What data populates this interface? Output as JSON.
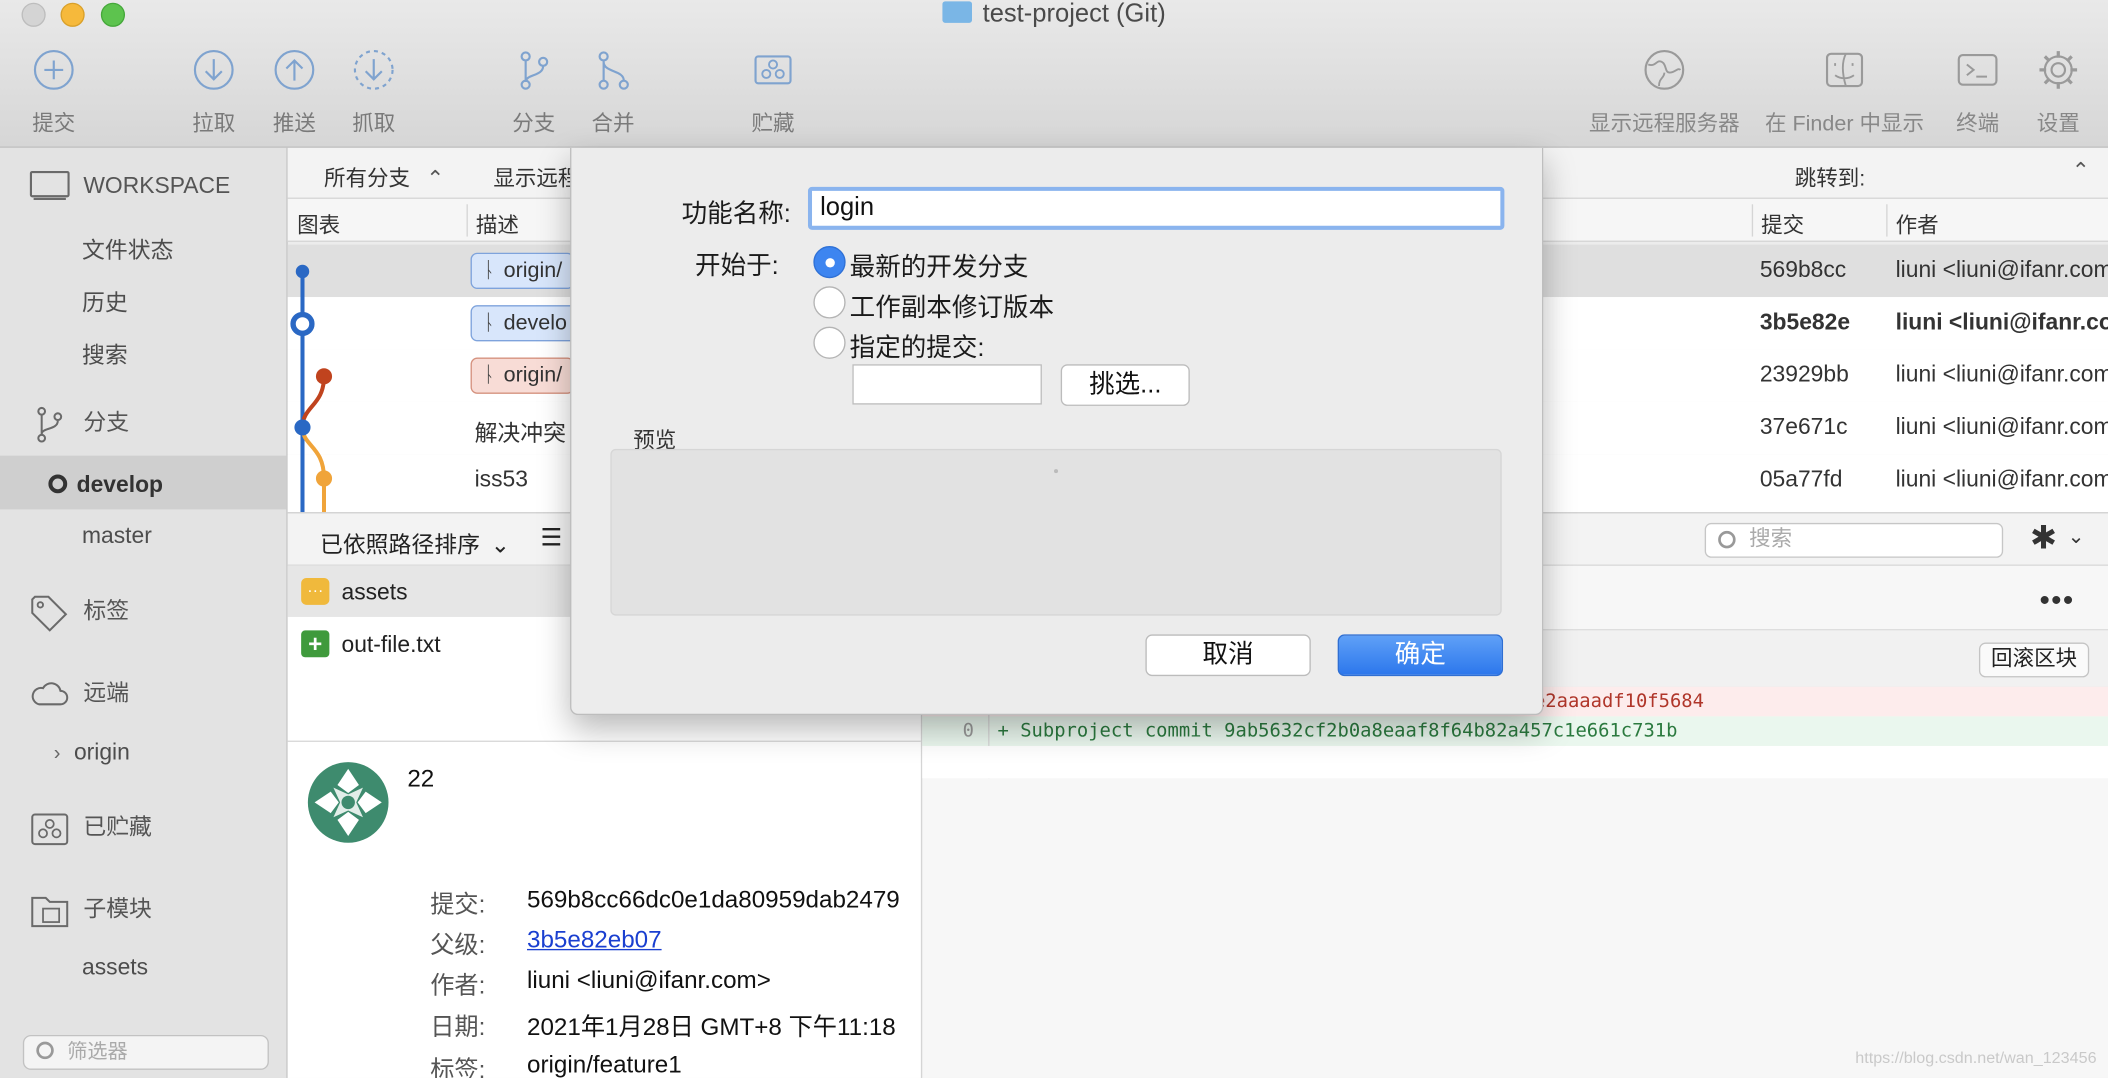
{
  "window": {
    "title": "test-project (Git)"
  },
  "toolbar": {
    "commit": "提交",
    "pull": "拉取",
    "push": "推送",
    "fetch": "抓取",
    "branch": "分支",
    "merge": "合并",
    "stash": "贮藏",
    "show_remote": "显示远程服务器",
    "show_in_finder": "在 Finder 中显示",
    "terminal": "终端",
    "settings": "设置"
  },
  "sidebar": {
    "workspace": "WORKSPACE",
    "file_status": "文件状态",
    "history": "历史",
    "search": "搜索",
    "branches": "分支",
    "develop": "develop",
    "master": "master",
    "tags": "标签",
    "remotes": "远端",
    "origin": "origin",
    "stashes": "已贮藏",
    "submodules": "子模块",
    "assets": "assets",
    "filter_placeholder": "筛选器"
  },
  "branchbar": {
    "all_branches": "所有分支",
    "show_remote": "显示远程",
    "jump_to": "跳转到:"
  },
  "columns": {
    "graph": "图表",
    "description": "描述",
    "commit": "提交",
    "author": "作者"
  },
  "commits": [
    {
      "desc": "origin/",
      "hash": "569b8cc",
      "author": "liuni <liuni@ifanr.com>"
    },
    {
      "desc": "develo",
      "hash": "3b5e82e",
      "author": "liuni <liuni@ifanr.com>"
    },
    {
      "desc": "origin/",
      "hash": "23929bb",
      "author": "liuni <liuni@ifanr.com>"
    },
    {
      "desc": "解决冲突",
      "hash": "37e671c",
      "author": "liuni <liuni@ifanr.com>"
    },
    {
      "desc": "iss53",
      "hash": "05a77fd",
      "author": "liuni <liuni@ifanr.com>"
    }
  ],
  "files": {
    "sort_label": "已依照路径排序",
    "search_placeholder": "搜索",
    "items": [
      "assets",
      "out-file.txt"
    ]
  },
  "details": {
    "message": "22",
    "commit_label": "提交:",
    "commit_value": "569b8cc66dc0e1da80959dab2479",
    "parent_label": "父级:",
    "parent_value": "3b5e82eb07",
    "author_label": "作者:",
    "author_value": "liuni <liuni@ifanr.com>",
    "date_label": "日期:",
    "date_value": "2021年1月28日 GMT+8 下午11:18",
    "tags_label": "标签:",
    "tags_value": "origin/feature1"
  },
  "diff": {
    "revert_hunk": "回滚区块",
    "removed_line": "e2aaaadf10f5684",
    "added_lineno": "0",
    "added_line": "+ Subproject commit 9ab5632cf2b0a8eaaf8f64b82a457c1e661c731b"
  },
  "dialog": {
    "name_label": "功能名称:",
    "name_value": "login",
    "start_label": "开始于:",
    "opt_latest": "最新的开发分支",
    "opt_working": "工作副本修订版本",
    "opt_commit": "指定的提交:",
    "pick_button": "挑选...",
    "preview_label": "预览",
    "cancel": "取消",
    "ok": "确定"
  },
  "watermark": "https://blog.csdn.net/wan_123456",
  "colors": {
    "accent": "#3d85f0",
    "graph_blue": "#2a68c4",
    "graph_red": "#c0431e",
    "graph_orange": "#f0a43a",
    "added_bg": "#eaf7ee",
    "removed_bg": "#fdecec"
  }
}
